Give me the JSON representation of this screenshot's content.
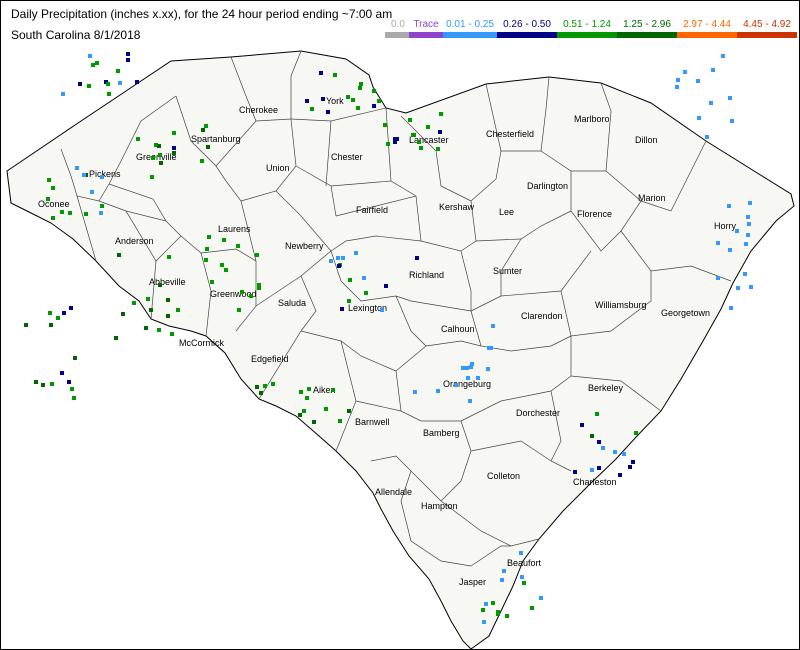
{
  "title": "Daily Precipitation (inches  x.xx),  for the 24 hour period ending ~7:00 am",
  "subtitle": "South Carolina 8/1/2018",
  "legend": [
    {
      "label": "0.0",
      "color": "#aaaaaa"
    },
    {
      "label": "Trace",
      "color": "#8e44cc"
    },
    {
      "label": "0.01 - 0.25",
      "color": "#3399ff"
    },
    {
      "label": "0.26 - 0.50",
      "color": "#000088"
    },
    {
      "label": "0.51 - 1.24",
      "color": "#009900"
    },
    {
      "label": "1.25 - 2.96",
      "color": "#006600"
    },
    {
      "label": "2.97 - 4.44",
      "color": "#ff6600"
    },
    {
      "label": "4.45 - 4.92",
      "color": "#cc3300"
    }
  ],
  "counties": [
    "Cherokee",
    "York",
    "Lancaster",
    "Chesterfield",
    "Marlboro",
    "Dillon",
    "Spartanburg",
    "Greenville",
    "Pickens",
    "Oconee",
    "Union",
    "Chester",
    "Darlington",
    "Marion",
    "Horry",
    "Fairfield",
    "Kershaw",
    "Lee",
    "Florence",
    "Anderson",
    "Laurens",
    "Newberry",
    "Richland",
    "Sumter",
    "Abbeville",
    "Greenwood",
    "Saluda",
    "Lexington",
    "Williamsburg",
    "Georgetown",
    "Clarendon",
    "Calhoun",
    "McCormick",
    "Edgefield",
    "Aiken",
    "Orangeburg",
    "Berkeley",
    "Barnwell",
    "Bamberg",
    "Dorchester",
    "Allendale",
    "Colleton",
    "Charleston",
    "Hampton",
    "Beaufort",
    "Jasper"
  ]
}
